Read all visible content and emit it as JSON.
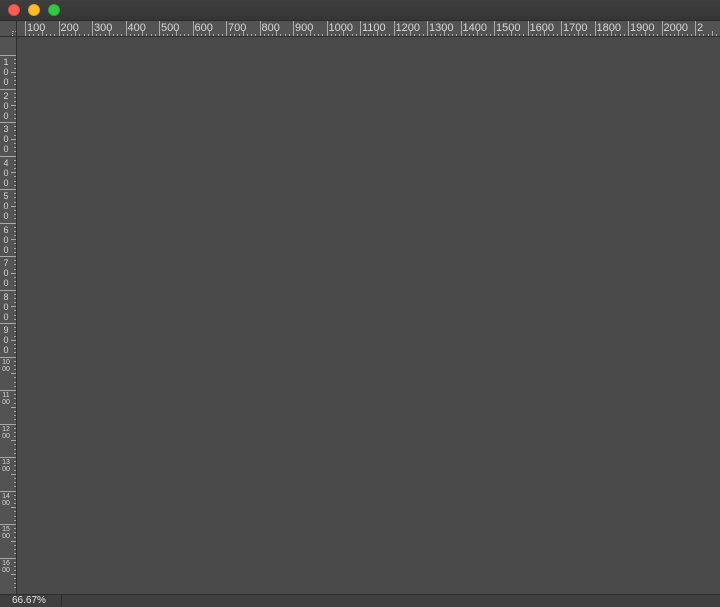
{
  "window": {
    "controls": {
      "close_icon": "close-icon",
      "minimize_icon": "minimize-icon",
      "maximize_icon": "zoom-icon"
    }
  },
  "horizontal_ruler": {
    "labels": [
      "100",
      "200",
      "300",
      "400",
      "500",
      "600",
      "700",
      "800",
      "900",
      "1000",
      "1100",
      "1200",
      "1300",
      "1400",
      "1500",
      "1600",
      "1700",
      "1800",
      "1900",
      "2000",
      "2"
    ]
  },
  "vertical_ruler": {
    "labels": [
      "100",
      "200",
      "300",
      "400",
      "500",
      "600",
      "700",
      "800",
      "900",
      "1000",
      "1100",
      "1200",
      "1300",
      "1400",
      "1500",
      "1600"
    ]
  },
  "status_bar": {
    "zoom": "66.67%"
  },
  "colors": {
    "canvas": "#4a4a4a",
    "ruler": "#535353",
    "close": "#fc5f57",
    "minimize": "#fdbc2e",
    "maximize": "#33c748"
  }
}
